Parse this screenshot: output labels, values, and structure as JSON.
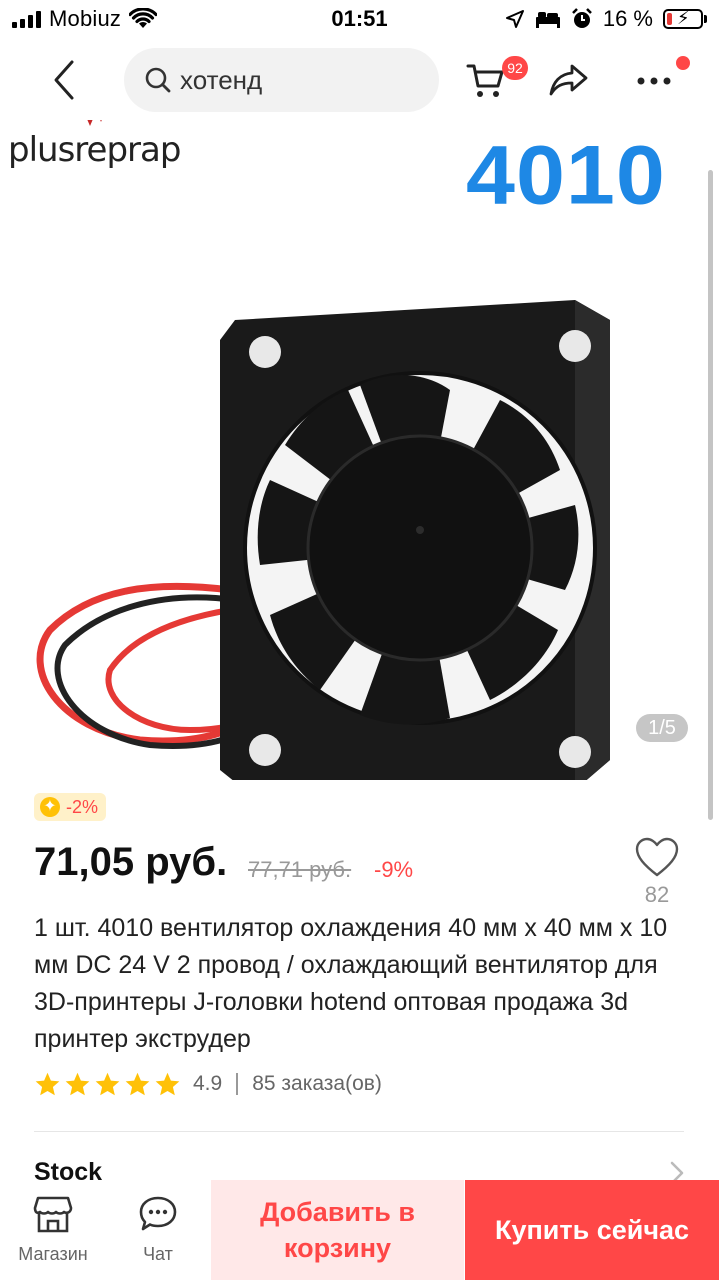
{
  "status_bar": {
    "carrier": "Mobiuz",
    "time": "01:51",
    "battery_percent": "16 %",
    "battery_level": 0.16
  },
  "header": {
    "search_text": "хотенд",
    "cart_badge": "92"
  },
  "gallery": {
    "brand_logo": "plusreprap",
    "model_label": "4010",
    "counter": "1/5"
  },
  "product": {
    "coin_discount": "-2%",
    "price": "71,05 руб.",
    "old_price": "77,71 руб.",
    "discount": "-9%",
    "wish_count": "82",
    "title": "1 шт. 4010 вентилятор охлаждения 40 мм х 40 мм х 10 мм DC 24 V 2 провод / охлаждающий вентилятор для 3D-принтеры J-головки hotend оптовая продажа 3d принтер экструдер",
    "rating": "4.9",
    "rating_stars": 5,
    "orders": "85 заказа(ов)",
    "stock_label": "Stock"
  },
  "bottom_bar": {
    "store_label": "Магазин",
    "chat_label": "Чат",
    "add_to_cart": "Добавить в корзину",
    "buy_now": "Купить сейчас"
  },
  "colors": {
    "accent": "#ff4747",
    "accent_light": "#ffe8e8",
    "star": "#ffc107",
    "model_blue": "#1e88e5"
  },
  "icons": [
    "signal-icon",
    "wifi-icon",
    "location-arrow-icon",
    "bed-icon",
    "alarm-icon",
    "battery-icon",
    "back-chevron-icon",
    "search-icon",
    "cart-icon",
    "share-icon",
    "more-icon",
    "coin-icon",
    "heart-icon",
    "star-icon",
    "chevron-right-icon",
    "store-icon",
    "chat-icon"
  ]
}
